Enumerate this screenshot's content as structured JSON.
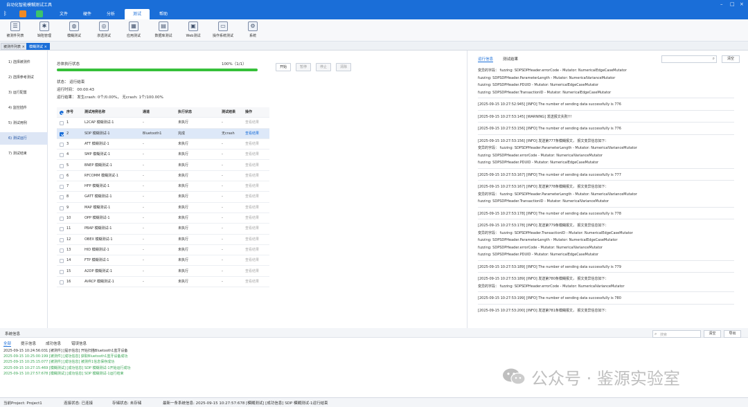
{
  "app": {
    "title": "自动化智能模糊测试工具"
  },
  "menu": {
    "tabs": [
      "文件",
      "硬件",
      "分析",
      "测试",
      "帮助"
    ],
    "active": "测试"
  },
  "toolbar": {
    "items": [
      "被测件列表",
      "缺陷管理",
      "模糊测试",
      "渗透测试",
      "应用测试",
      "数据库测试",
      "Web测试",
      "操作系统测试",
      "系统"
    ]
  },
  "doc_tabs": [
    "被测件列表",
    "模糊测试"
  ],
  "sidebar": {
    "items": [
      "1) 选择被测件",
      "2) 选择参考测试",
      "3) 运行配置",
      "4) 监控插件",
      "5) 测试用例",
      "6) 测试运行",
      "7) 测试结束"
    ],
    "active_index": 5
  },
  "overall": {
    "label": "总体执行状态",
    "progress_text": "100%（1/1）",
    "progress": 1.0,
    "status": "状态：  运行结束",
    "elapsed": "运行时间：  00:00:43",
    "result": "运行结果：  发生crash: 0个/0.00%，  无crash: 1个/100.00%"
  },
  "buttons": {
    "start": "开始",
    "pause": "暂停",
    "stop": "停止",
    "clear": "清除"
  },
  "table": {
    "headers": [
      "序号",
      "测试用例名称",
      "通道",
      "执行状态",
      "测试结果",
      "操作"
    ],
    "rows": [
      {
        "no": "1",
        "name": "L2CAP 模糊测试-1",
        "channel": "-",
        "status": "未执行",
        "result": "-",
        "action": "查看结果",
        "checked": false,
        "active": false
      },
      {
        "no": "2",
        "name": "SDP 模糊测试-1",
        "channel": "Bluetooth1",
        "status": "完成",
        "result": "无crash",
        "action": "查看结果",
        "checked": true,
        "active": true
      },
      {
        "no": "3",
        "name": "ATT 模糊测试-1",
        "channel": "-",
        "status": "未执行",
        "result": "-",
        "action": "查看结果",
        "checked": false,
        "active": false
      },
      {
        "no": "4",
        "name": "SMP 模糊测试-1",
        "channel": "-",
        "status": "未执行",
        "result": "-",
        "action": "查看结果",
        "checked": false,
        "active": false
      },
      {
        "no": "5",
        "name": "BNEP 模糊测试-1",
        "channel": "-",
        "status": "未执行",
        "result": "-",
        "action": "查看结果",
        "checked": false,
        "active": false
      },
      {
        "no": "6",
        "name": "RFCOMM 模糊测试-1",
        "channel": "-",
        "status": "未执行",
        "result": "-",
        "action": "查看结果",
        "checked": false,
        "active": false
      },
      {
        "no": "7",
        "name": "HFP 模糊测试-1",
        "channel": "-",
        "status": "未执行",
        "result": "-",
        "action": "查看结果",
        "checked": false,
        "active": false
      },
      {
        "no": "8",
        "name": "GATT 模糊测试-1",
        "channel": "-",
        "status": "未执行",
        "result": "-",
        "action": "查看结果",
        "checked": false,
        "active": false
      },
      {
        "no": "9",
        "name": "MAP 模糊测试-1",
        "channel": "-",
        "status": "未执行",
        "result": "-",
        "action": "查看结果",
        "checked": false,
        "active": false
      },
      {
        "no": "10",
        "name": "OPP 模糊测试-1",
        "channel": "-",
        "status": "未执行",
        "result": "-",
        "action": "查看结果",
        "checked": false,
        "active": false
      },
      {
        "no": "11",
        "name": "PBAP 模糊测试-1",
        "channel": "-",
        "status": "未执行",
        "result": "-",
        "action": "查看结果",
        "checked": false,
        "active": false
      },
      {
        "no": "12",
        "name": "OBEX 模糊测试-1",
        "channel": "-",
        "status": "未执行",
        "result": "-",
        "action": "查看结果",
        "checked": false,
        "active": false
      },
      {
        "no": "13",
        "name": "HID 模糊测试-1",
        "channel": "-",
        "status": "未执行",
        "result": "-",
        "action": "查看结果",
        "checked": false,
        "active": false
      },
      {
        "no": "14",
        "name": "FTP 模糊测试-1",
        "channel": "-",
        "status": "未执行",
        "result": "-",
        "action": "查看结果",
        "checked": false,
        "active": false
      },
      {
        "no": "15",
        "name": "A2DP 模糊测试-1",
        "channel": "-",
        "status": "未执行",
        "result": "-",
        "action": "查看结果",
        "checked": false,
        "active": false
      },
      {
        "no": "16",
        "name": "AVRCP 模糊测试-1",
        "channel": "-",
        "status": "未执行",
        "result": "-",
        "action": "查看结果",
        "checked": false,
        "active": false
      }
    ]
  },
  "right_panel": {
    "tabs": [
      "运行信息",
      "测试结果"
    ],
    "active_tab": "运行信息",
    "search_placeholder": "",
    "clear_label": "清空",
    "log": [
      "变异的字段：  fuzzing:  SDPSDPHeader.errorCode - Mutator: NumericalEdgeCaseMutator",
      "fuzzing:  SDPSDPHeader.ParameterLength - Mutator: NumericalVarianceMutator",
      "fuzzing:  SDPSDPHeader.PDUID - Mutator: NumericalEdgeCaseMutator",
      "fuzzing:  SDPSDPHeader.TransactionID - Mutator: NumericalEdgeCaseMutator",
      "---",
      "[2025-09-15 10:27:52:945] [INFO] The number of sending data successfully is 776",
      "---",
      "[2025-09-15 10:27:53:145] [WARNING] 发送报文失败!!!",
      "---",
      "[2025-09-15 10:27:53:156] [INFO] The number of sending data successfully is 776",
      "---",
      "[2025-09-15 10:27:53:156] [INFO] 发送第777条模糊报文，  报文变异信息如下：",
      "变异的字段：  fuzzing:  SDPSDPHeader.ParameterLength - Mutator: NumericalVarianceMutator",
      "fuzzing:  SDPSDPHeader.errorCode - Mutator: NumericalVarianceMutator",
      "fuzzing:  SDPSDPHeader.PDUID - Mutator: NumericalEdgeCaseMutator",
      "---",
      "[2025-09-15 10:27:53:167] [INFO] The number of sending data successfully is 777",
      "---",
      "[2025-09-15 10:27:53:167] [INFO] 发送第778条模糊报文，  报文变异信息如下：",
      "变异的字段：  fuzzing:  SDPSDPHeader.ParameterLength - Mutator: NumericalVarianceMutator",
      "fuzzing:  SDPSDPHeader.TransactionID - Mutator: NumericalVarianceMutator",
      "---",
      "[2025-09-15 10:27:53:178] [INFO] The number of sending data successfully is 778",
      "---",
      "[2025-09-15 10:27:53:178] [INFO] 发送第779条模糊报文，  报文变异信息如下：",
      "变异的字段：  fuzzing:  SDPSDPHeader.TransactionID - Mutator: NumericalEdgeCaseMutator",
      "fuzzing:  SDPSDPHeader.ParameterLength - Mutator: NumericalEdgeCaseMutator",
      "fuzzing:  SDPSDPHeader.errorCode - Mutator: NumericalVarianceMutator",
      "fuzzing:  SDPSDPHeader.PDUID - Mutator: NumericalEdgeCaseMutator",
      "---",
      "[2025-09-15 10:27:53:189] [INFO] The number of sending data successfully is 779",
      "---",
      "[2025-09-15 10:27:53:189] [INFO] 发送第780条模糊报文，  报文变异信息如下：",
      "变异的字段：  fuzzing:  SDPSDPHeader.errorCode - Mutator: NumericalVarianceMutator",
      "---",
      "[2025-09-15 10:27:53:199] [INFO] The number of sending data successfully is 780",
      "---",
      "[2025-09-15 10:27:53:200] [INFO] 发送第781条模糊报文，  报文变异信息如下："
    ]
  },
  "bottom": {
    "title": "系统信息",
    "tabs": [
      "全部",
      "提示信息",
      "成功信息",
      "错误信息"
    ],
    "active_tab": "全部",
    "search_placeholder": "搜索",
    "clear_label": "清空",
    "export_label": "导出",
    "lines": [
      {
        "text": "2025-09-15 10:24:56:031 [被测件] [提示信息] 开始扫描Bluetooth1蓝牙设备",
        "color": "#333333"
      },
      {
        "text": "2025-09-15 10:25:00:199 [被测件] [成功信息] 获取Bluetooth1蓝牙设备成功",
        "color": "#3aa655"
      },
      {
        "text": "2025-09-15 10:25:15:077 [被测件] [成功信息] 被测件1信息保存成功",
        "color": "#3aa655"
      },
      {
        "text": "2025-09-15 10:27:15:469 [模糊测试] [成功信息] SDP 模糊测试-1开始运行成功",
        "color": "#3aa655"
      },
      {
        "text": "2025-09-15 10:27:57:678 [模糊测试] [成功信息] SDP 模糊测试-1运行结束",
        "color": "#3aa655"
      }
    ]
  },
  "status_bar": {
    "project": "当前Project:  Project1",
    "conn": "连接状态:  已连接",
    "storage": "存储状态:  未存储",
    "last_info": "最新一条系统信息:  2025-09-15 10:27:57:678 [模糊测试] [成功信息] SDP 模糊测试-1运行结束"
  },
  "watermark": {
    "text": "公众号 · 鉴源实验室"
  }
}
